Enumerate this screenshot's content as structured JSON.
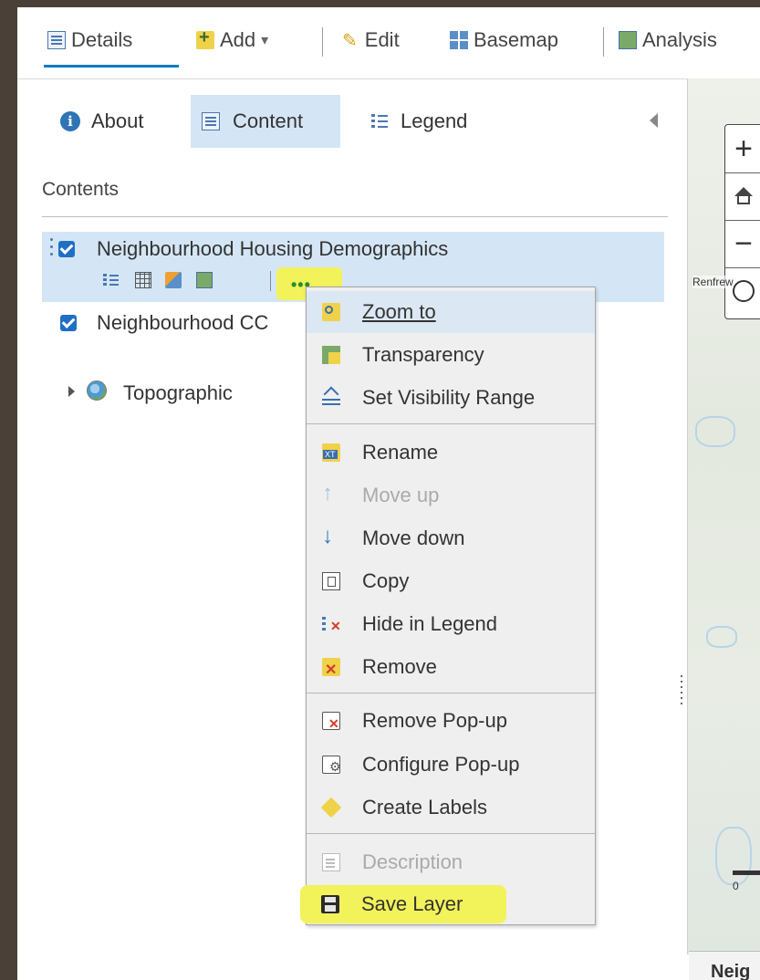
{
  "toolbar": {
    "details_label": "Details",
    "add_label": "Add",
    "add_caret": "▾",
    "edit_label": "Edit",
    "basemap_label": "Basemap",
    "analysis_label": "Analysis",
    "accent_color": "#0079c1"
  },
  "panel_tabs": {
    "about_label": "About",
    "content_label": "Content",
    "legend_label": "Legend",
    "active": "Content"
  },
  "contents": {
    "title": "Contents",
    "layers": [
      {
        "name": "Neighbourhood Housing Demographics",
        "checked": true,
        "selected": true
      },
      {
        "name": "Neighbourhood CC",
        "checked": true,
        "selected": false
      }
    ],
    "basemap_name": "Topographic",
    "more_label": "•••"
  },
  "map": {
    "zoom_in": "+",
    "zoom_out": "−",
    "place_label": "Renfrew",
    "scale_zero": "0",
    "bottom_text": "Neig"
  },
  "context_menu": {
    "items": [
      {
        "label": "Zoom to",
        "icon": "zoom-to-icon",
        "hover": true
      },
      {
        "label": "Transparency",
        "icon": "transparency-icon"
      },
      {
        "label": "Set Visibility Range",
        "icon": "visibility-range-icon"
      },
      {
        "label": "Rename",
        "icon": "rename-icon"
      },
      {
        "label": "Move up",
        "icon": "move-up-icon",
        "disabled": true
      },
      {
        "label": "Move down",
        "icon": "move-down-icon"
      },
      {
        "label": "Copy",
        "icon": "copy-icon"
      },
      {
        "label": "Hide in Legend",
        "icon": "hide-legend-icon"
      },
      {
        "label": "Remove",
        "icon": "remove-icon"
      },
      {
        "label": "Remove Pop-up",
        "icon": "remove-popup-icon"
      },
      {
        "label": "Configure Pop-up",
        "icon": "configure-popup-icon"
      },
      {
        "label": "Create Labels",
        "icon": "create-labels-icon"
      },
      {
        "label": "Description",
        "icon": "description-icon",
        "disabled": true
      },
      {
        "label": "Save Layer",
        "icon": "save-layer-icon"
      }
    ],
    "highlight_color": "#f2f25a"
  }
}
